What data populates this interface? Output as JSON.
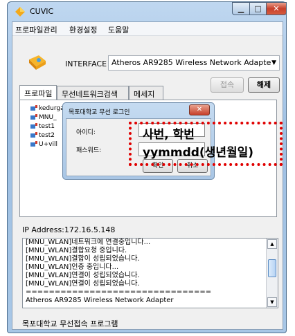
{
  "window": {
    "title": "CUVIC"
  },
  "menu": [
    "프로파일관리",
    "환경설정",
    "도움말"
  ],
  "interface": {
    "label": "INTERFACE",
    "selected": "Atheros AR9285 Wireless Network Adapte"
  },
  "tabs": [
    "프로파일",
    "무선네트워크검색",
    "메세지"
  ],
  "buttons": {
    "connect": "접속",
    "disconnect": "해제"
  },
  "profiles": [
    "kedurgam",
    "MNU_",
    "test1",
    "test2",
    "U+vill"
  ],
  "login": {
    "title": "목포대학교 무선 로그인",
    "id_label": "아이디:",
    "pw_label": "패스워드:",
    "ok": "확인",
    "cancel": "취소",
    "id_hint": "사번, 학번",
    "pw_hint": "yymmdd(생년월일)"
  },
  "ip": "IP Address:172.16.5.148",
  "log": [
    "[MNU_WLAN]네트워크에 연결중입니다...",
    "[MNU_WLAN]결합요청 중입니다.",
    "[MNU_WLAN]결합이 성립되었습니다.",
    "[MNU_WLAN]인증 중입니다...",
    "[MNU_WLAN]연결이 성립되었습니다.",
    "[MNU_WLAN]연결이 성립되었습니다.",
    "================================",
    "Atheros AR9285 Wireless Network Adapter"
  ],
  "status": "목포대학교 무선접속 프로그램",
  "colors": {
    "highlight": "#e00000",
    "titlebar": "#a9c6e5",
    "close": "#c7402b"
  }
}
